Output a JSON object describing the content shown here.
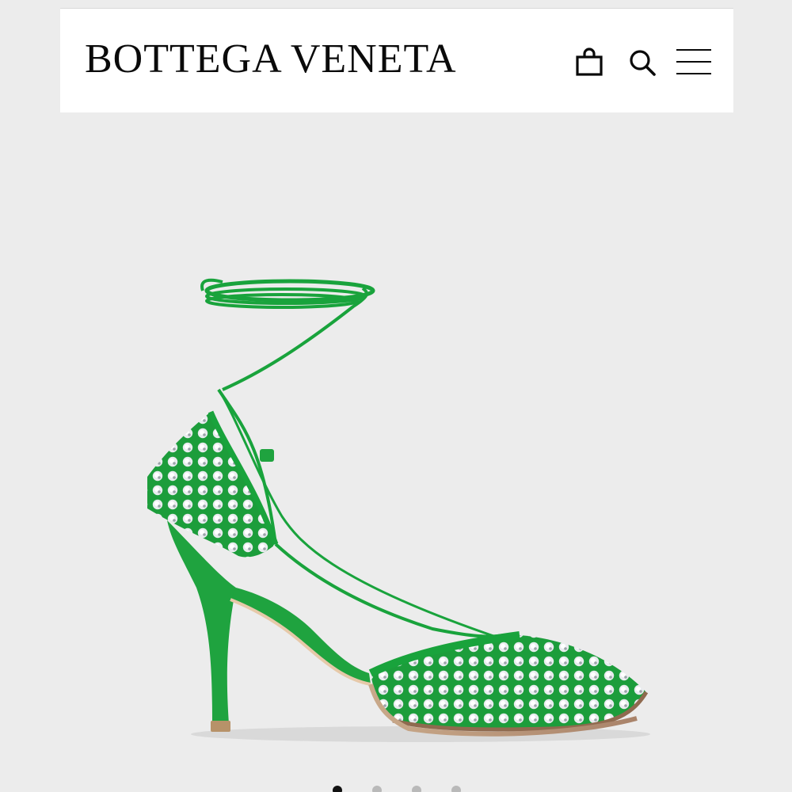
{
  "header": {
    "brand": "BOTTEGA VENETA",
    "icons": [
      "shopping-bag-icon",
      "search-icon",
      "hamburger-menu-icon"
    ]
  },
  "product": {
    "image_name": "green-crystal-mesh-lace-up-heel",
    "accent_color": "#19a33c",
    "background_color": "#ececec"
  },
  "carousel": {
    "dot_count": 4,
    "active_index": 0
  }
}
